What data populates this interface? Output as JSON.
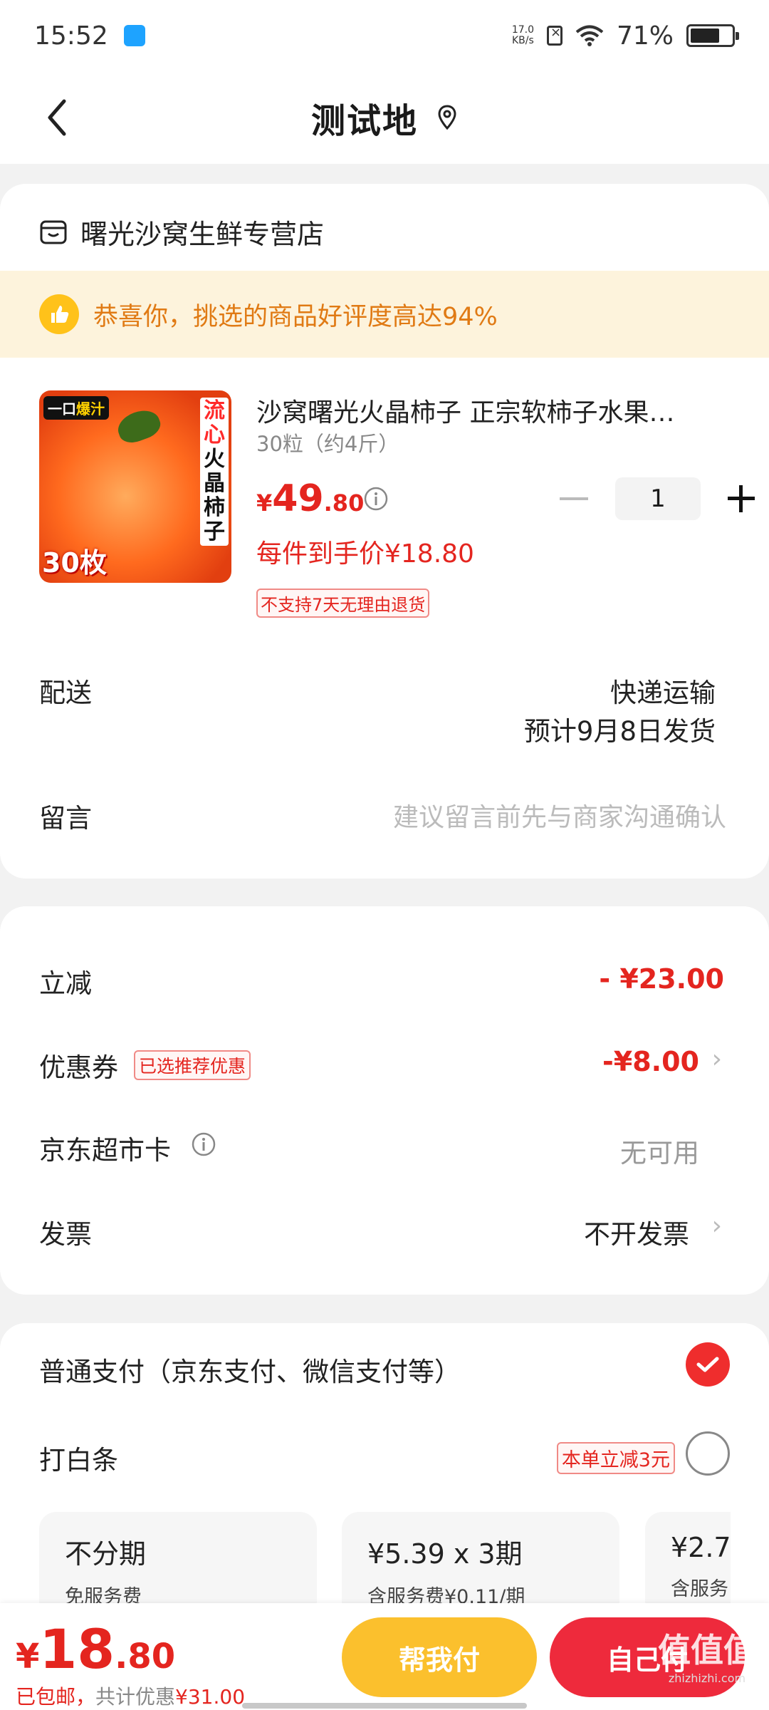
{
  "status_bar": {
    "time": "15:52",
    "net_speed_value": "17.0",
    "net_speed_unit": "KB/s",
    "battery_percent": "71%",
    "battery_level": 0.71
  },
  "nav": {
    "title": "测试地"
  },
  "store": {
    "name": "曙光沙窝生鲜专营店",
    "banner": "恭喜你，挑选的商品好评度高达94%"
  },
  "product": {
    "image_tag_a": "一口",
    "image_tag_b": "爆汁",
    "image_vertical_red": "流心",
    "image_vertical_black": "火晶柿子",
    "image_count": "30枚",
    "title": "沙窝曙光火晶柿子 正宗软柿子水果…",
    "spec": "30粒（约4斤）",
    "price_symbol": "¥",
    "price_int": "49",
    "price_dec": ".80",
    "quantity": "1",
    "deal_price": "每件到手价¥18.80",
    "no_return": "不支持7天无理由退货"
  },
  "delivery": {
    "label": "配送",
    "method": "快递运输",
    "eta": "预计9月8日发货"
  },
  "message": {
    "label": "留言",
    "placeholder": "建议留言前先与商家沟通确认"
  },
  "discounts": {
    "instant_label": "立减",
    "instant_value": "- ¥23.00",
    "coupon_label": "优惠券",
    "coupon_tag": "已选推荐优惠",
    "coupon_value": "-¥8.00",
    "card_label": "京东超市卡",
    "card_value": "无可用",
    "invoice_label": "发票",
    "invoice_value": "不开发票"
  },
  "payment": {
    "normal_label": "普通支付（京东支付、微信支付等）",
    "baitiao_label": "打白条",
    "baitiao_tag": "本单立减3元",
    "plans": [
      {
        "title": "不分期",
        "sub": "免服务费"
      },
      {
        "title": "¥5.39 x 3期",
        "sub": "含服务费¥0.11/期"
      },
      {
        "title": "¥2.7",
        "sub": "含服务"
      }
    ]
  },
  "bottom": {
    "total_symbol": "¥",
    "total_int": "18",
    "total_dec": ".80",
    "note_free": "已包邮，",
    "note_mid": "共计优惠",
    "note_amount": "¥31.00",
    "help_pay": "帮我付",
    "self_pay": "自己付",
    "watermark": "值值值",
    "watermark_sub": "zhizhizhi.com"
  },
  "colors": {
    "accent_red": "#e4251f",
    "banner_bg": "#fdf3dc",
    "help_btn": "#fbc02d",
    "self_btn": "#ee2a3c"
  },
  "icons": [
    "back-icon",
    "location-pin-icon",
    "store-icon",
    "thumbs-up-icon",
    "info-icon",
    "minus-icon",
    "plus-icon",
    "chevron-right-icon",
    "check-icon",
    "wifi-icon",
    "sim-icon",
    "battery-icon"
  ]
}
